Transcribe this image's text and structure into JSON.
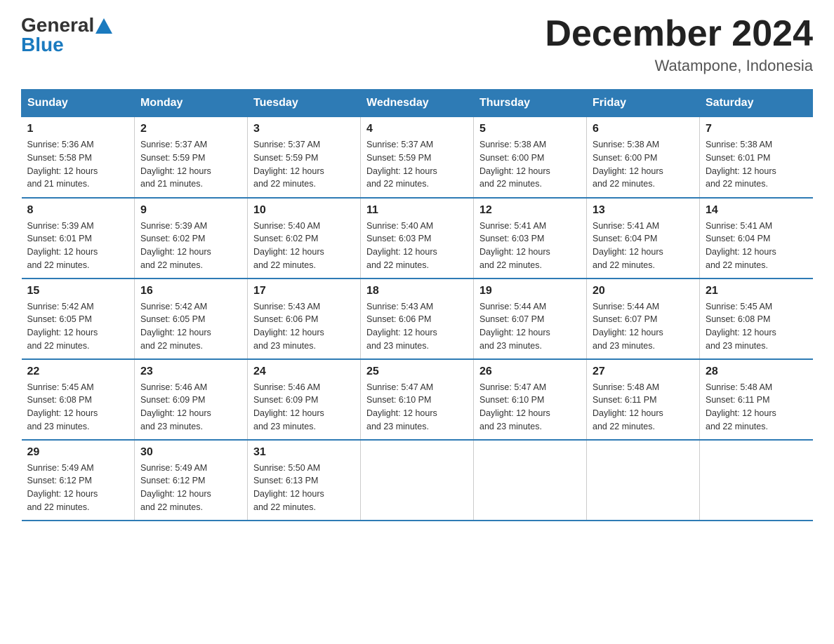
{
  "header": {
    "logo_general": "General",
    "logo_blue": "Blue",
    "month_year": "December 2024",
    "location": "Watampone, Indonesia"
  },
  "days_of_week": [
    "Sunday",
    "Monday",
    "Tuesday",
    "Wednesday",
    "Thursday",
    "Friday",
    "Saturday"
  ],
  "weeks": [
    [
      {
        "day": "1",
        "sunrise": "5:36 AM",
        "sunset": "5:58 PM",
        "daylight": "12 hours and 21 minutes."
      },
      {
        "day": "2",
        "sunrise": "5:37 AM",
        "sunset": "5:59 PM",
        "daylight": "12 hours and 21 minutes."
      },
      {
        "day": "3",
        "sunrise": "5:37 AM",
        "sunset": "5:59 PM",
        "daylight": "12 hours and 22 minutes."
      },
      {
        "day": "4",
        "sunrise": "5:37 AM",
        "sunset": "5:59 PM",
        "daylight": "12 hours and 22 minutes."
      },
      {
        "day": "5",
        "sunrise": "5:38 AM",
        "sunset": "6:00 PM",
        "daylight": "12 hours and 22 minutes."
      },
      {
        "day": "6",
        "sunrise": "5:38 AM",
        "sunset": "6:00 PM",
        "daylight": "12 hours and 22 minutes."
      },
      {
        "day": "7",
        "sunrise": "5:38 AM",
        "sunset": "6:01 PM",
        "daylight": "12 hours and 22 minutes."
      }
    ],
    [
      {
        "day": "8",
        "sunrise": "5:39 AM",
        "sunset": "6:01 PM",
        "daylight": "12 hours and 22 minutes."
      },
      {
        "day": "9",
        "sunrise": "5:39 AM",
        "sunset": "6:02 PM",
        "daylight": "12 hours and 22 minutes."
      },
      {
        "day": "10",
        "sunrise": "5:40 AM",
        "sunset": "6:02 PM",
        "daylight": "12 hours and 22 minutes."
      },
      {
        "day": "11",
        "sunrise": "5:40 AM",
        "sunset": "6:03 PM",
        "daylight": "12 hours and 22 minutes."
      },
      {
        "day": "12",
        "sunrise": "5:41 AM",
        "sunset": "6:03 PM",
        "daylight": "12 hours and 22 minutes."
      },
      {
        "day": "13",
        "sunrise": "5:41 AM",
        "sunset": "6:04 PM",
        "daylight": "12 hours and 22 minutes."
      },
      {
        "day": "14",
        "sunrise": "5:41 AM",
        "sunset": "6:04 PM",
        "daylight": "12 hours and 22 minutes."
      }
    ],
    [
      {
        "day": "15",
        "sunrise": "5:42 AM",
        "sunset": "6:05 PM",
        "daylight": "12 hours and 22 minutes."
      },
      {
        "day": "16",
        "sunrise": "5:42 AM",
        "sunset": "6:05 PM",
        "daylight": "12 hours and 22 minutes."
      },
      {
        "day": "17",
        "sunrise": "5:43 AM",
        "sunset": "6:06 PM",
        "daylight": "12 hours and 23 minutes."
      },
      {
        "day": "18",
        "sunrise": "5:43 AM",
        "sunset": "6:06 PM",
        "daylight": "12 hours and 23 minutes."
      },
      {
        "day": "19",
        "sunrise": "5:44 AM",
        "sunset": "6:07 PM",
        "daylight": "12 hours and 23 minutes."
      },
      {
        "day": "20",
        "sunrise": "5:44 AM",
        "sunset": "6:07 PM",
        "daylight": "12 hours and 23 minutes."
      },
      {
        "day": "21",
        "sunrise": "5:45 AM",
        "sunset": "6:08 PM",
        "daylight": "12 hours and 23 minutes."
      }
    ],
    [
      {
        "day": "22",
        "sunrise": "5:45 AM",
        "sunset": "6:08 PM",
        "daylight": "12 hours and 23 minutes."
      },
      {
        "day": "23",
        "sunrise": "5:46 AM",
        "sunset": "6:09 PM",
        "daylight": "12 hours and 23 minutes."
      },
      {
        "day": "24",
        "sunrise": "5:46 AM",
        "sunset": "6:09 PM",
        "daylight": "12 hours and 23 minutes."
      },
      {
        "day": "25",
        "sunrise": "5:47 AM",
        "sunset": "6:10 PM",
        "daylight": "12 hours and 23 minutes."
      },
      {
        "day": "26",
        "sunrise": "5:47 AM",
        "sunset": "6:10 PM",
        "daylight": "12 hours and 23 minutes."
      },
      {
        "day": "27",
        "sunrise": "5:48 AM",
        "sunset": "6:11 PM",
        "daylight": "12 hours and 22 minutes."
      },
      {
        "day": "28",
        "sunrise": "5:48 AM",
        "sunset": "6:11 PM",
        "daylight": "12 hours and 22 minutes."
      }
    ],
    [
      {
        "day": "29",
        "sunrise": "5:49 AM",
        "sunset": "6:12 PM",
        "daylight": "12 hours and 22 minutes."
      },
      {
        "day": "30",
        "sunrise": "5:49 AM",
        "sunset": "6:12 PM",
        "daylight": "12 hours and 22 minutes."
      },
      {
        "day": "31",
        "sunrise": "5:50 AM",
        "sunset": "6:13 PM",
        "daylight": "12 hours and 22 minutes."
      },
      null,
      null,
      null,
      null
    ]
  ],
  "labels": {
    "sunrise": "Sunrise:",
    "sunset": "Sunset:",
    "daylight": "Daylight:"
  }
}
